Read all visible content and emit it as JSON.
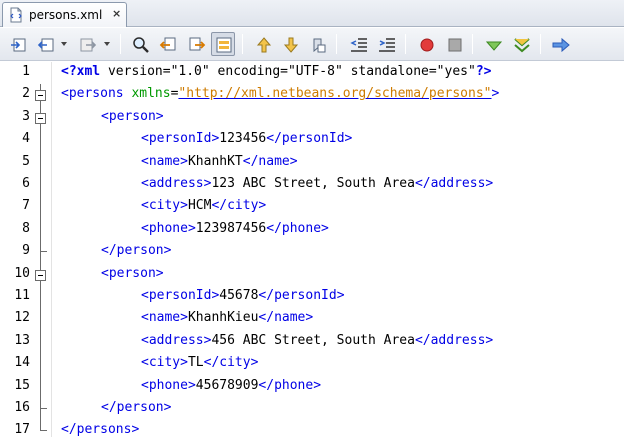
{
  "tab": {
    "title": "persons.xml",
    "close_glyph": "×",
    "icon": "xml-file-icon"
  },
  "toolbar": {
    "buttons": [
      "last-edit-icon",
      "back-icon",
      "forward-icon",
      "find-icon",
      "find-previous-icon",
      "find-next-icon",
      "toggle-highlight-icon",
      "previous-bookmark-icon",
      "next-bookmark-icon",
      "toggle-bookmark-icon",
      "shift-left-icon",
      "shift-right-icon",
      "start-macro-icon",
      "stop-macro-icon",
      "check-xml-icon",
      "validate-xml-icon",
      "xsl-transform-icon"
    ]
  },
  "editor": {
    "lines": [
      {
        "n": "1",
        "fold": "none",
        "tokens": [
          {
            "c": "pi",
            "t": "<?xml"
          },
          {
            "c": "txt",
            "t": " version=\"1.0\" encoding=\"UTF-8\" standalone=\"yes\""
          },
          {
            "c": "pi",
            "t": "?>"
          }
        ]
      },
      {
        "n": "2",
        "fold": "open",
        "tokens": [
          {
            "c": "tag",
            "t": "<persons"
          },
          {
            "c": "txt",
            "t": " "
          },
          {
            "c": "attr",
            "t": "xmlns"
          },
          {
            "c": "txt",
            "t": "="
          },
          {
            "c": "url",
            "t": "\"http://xml.netbeans.org/schema/persons\""
          },
          {
            "c": "tag",
            "t": ">"
          }
        ]
      },
      {
        "n": "3",
        "fold": "open",
        "indent": 1,
        "tokens": [
          {
            "c": "tag",
            "t": "<person>"
          }
        ]
      },
      {
        "n": "4",
        "fold": "line",
        "indent": 2,
        "tokens": [
          {
            "c": "tag",
            "t": "<personId>"
          },
          {
            "c": "txt",
            "t": "123456"
          },
          {
            "c": "tag",
            "t": "</personId>"
          }
        ]
      },
      {
        "n": "5",
        "fold": "line",
        "indent": 2,
        "tokens": [
          {
            "c": "tag",
            "t": "<name>"
          },
          {
            "c": "txt",
            "t": "KhanhKT"
          },
          {
            "c": "tag",
            "t": "</name>"
          }
        ]
      },
      {
        "n": "6",
        "fold": "line",
        "indent": 2,
        "tokens": [
          {
            "c": "tag",
            "t": "<address>"
          },
          {
            "c": "txt",
            "t": "123 ABC Street, South Area"
          },
          {
            "c": "tag",
            "t": "</address>"
          }
        ]
      },
      {
        "n": "7",
        "fold": "line",
        "indent": 2,
        "tokens": [
          {
            "c": "tag",
            "t": "<city>"
          },
          {
            "c": "txt",
            "t": "HCM"
          },
          {
            "c": "tag",
            "t": "</city>"
          }
        ]
      },
      {
        "n": "8",
        "fold": "line",
        "indent": 2,
        "tokens": [
          {
            "c": "tag",
            "t": "<phone>"
          },
          {
            "c": "txt",
            "t": "123987456"
          },
          {
            "c": "tag",
            "t": "</phone>"
          }
        ]
      },
      {
        "n": "9",
        "fold": "end",
        "indent": 1,
        "tokens": [
          {
            "c": "tag",
            "t": "</person>"
          }
        ]
      },
      {
        "n": "10",
        "fold": "open",
        "indent": 1,
        "tokens": [
          {
            "c": "tag",
            "t": "<person>"
          }
        ]
      },
      {
        "n": "11",
        "fold": "line",
        "indent": 2,
        "tokens": [
          {
            "c": "tag",
            "t": "<personId>"
          },
          {
            "c": "txt",
            "t": "45678"
          },
          {
            "c": "tag",
            "t": "</personId>"
          }
        ]
      },
      {
        "n": "12",
        "fold": "line",
        "indent": 2,
        "tokens": [
          {
            "c": "tag",
            "t": "<name>"
          },
          {
            "c": "txt",
            "t": "KhanhKieu"
          },
          {
            "c": "tag",
            "t": "</name>"
          }
        ]
      },
      {
        "n": "13",
        "fold": "line",
        "indent": 2,
        "tokens": [
          {
            "c": "tag",
            "t": "<address>"
          },
          {
            "c": "txt",
            "t": "456 ABC Street, South Area"
          },
          {
            "c": "tag",
            "t": "</address>"
          }
        ]
      },
      {
        "n": "14",
        "fold": "line",
        "indent": 2,
        "tokens": [
          {
            "c": "tag",
            "t": "<city>"
          },
          {
            "c": "txt",
            "t": "TL"
          },
          {
            "c": "tag",
            "t": "</city>"
          }
        ]
      },
      {
        "n": "15",
        "fold": "line",
        "indent": 2,
        "tokens": [
          {
            "c": "tag",
            "t": "<phone>"
          },
          {
            "c": "txt",
            "t": "45678909"
          },
          {
            "c": "tag",
            "t": "</phone>"
          }
        ]
      },
      {
        "n": "16",
        "fold": "end",
        "indent": 1,
        "tokens": [
          {
            "c": "tag",
            "t": "</person>"
          }
        ]
      },
      {
        "n": "17",
        "fold": "end",
        "tokens": [
          {
            "c": "tag",
            "t": "</persons>"
          }
        ]
      }
    ]
  }
}
